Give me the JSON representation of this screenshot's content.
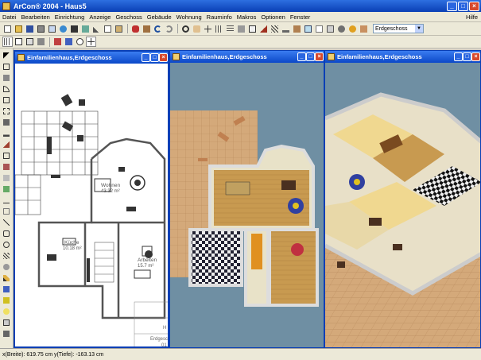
{
  "app": {
    "title": "ArCon® 2004 - Haus5"
  },
  "menu": {
    "items": [
      "Datei",
      "Bearbeiten",
      "Einrichtung",
      "Anzeige",
      "Geschoss",
      "Gebäude",
      "Wohnung",
      "Rauminfo",
      "Makros",
      "Optionen",
      "Fenster"
    ],
    "help": "Hilfe"
  },
  "toolbar": {
    "floor_select_value": "Erdgeschoss"
  },
  "windows": [
    {
      "title": "Einfamilienhaus,Erdgeschoss",
      "view": "2d-plan"
    },
    {
      "title": "Einfamilienhaus,Erdgeschoss",
      "view": "3d-top"
    },
    {
      "title": "Einfamilienhaus,Erdgeschoss",
      "view": "3d-iso"
    }
  ],
  "plan": {
    "rooms": [
      {
        "name": "Wohnen",
        "area": "43.32 m²"
      },
      {
        "name": "Küche",
        "area": "10.18 m²"
      },
      {
        "name": "Arbeiten",
        "area": "15.7 m²"
      }
    ],
    "corner_labels": [
      "H",
      "Erdgesc",
      "01"
    ]
  },
  "status": {
    "coordinates": "x(Breite): 619.75 cm  y(Tiefe): -163.13 cm"
  },
  "colors": {
    "title_bar": "#0a3fb5",
    "view_background": "#6f8fa3",
    "floor_tile": "#d4a97a"
  }
}
